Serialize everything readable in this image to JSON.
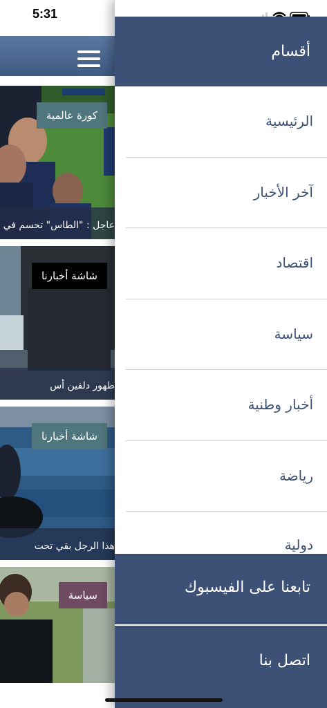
{
  "status_bar": {
    "time": "5:31",
    "icons": [
      "signal-icon",
      "wifi-icon",
      "battery-icon"
    ]
  },
  "main": {
    "app_bar": {
      "menu_icon": "hamburger-menu-icon"
    },
    "cards": [
      {
        "badge": "كورة عالمية",
        "badge_color": "#4f767c",
        "caption": "عاجل : \"الطاس\" تحسم في"
      },
      {
        "badge": "شاشة أخبارنا",
        "badge_color": "#000000",
        "caption": "ظهور دلفين أس"
      },
      {
        "badge": "شاشة أخبارنا",
        "badge_color": "#4f767c",
        "caption": "هذا الرجل بقي تحت"
      },
      {
        "badge": "سياسة",
        "badge_color": "#6e4b63",
        "caption": ""
      }
    ]
  },
  "drawer": {
    "header_title": "أقسام",
    "items": [
      {
        "label": "الرئيسية"
      },
      {
        "label": "آخر الأخبار"
      },
      {
        "label": "اقتصاد"
      },
      {
        "label": "سياسة"
      },
      {
        "label": "أخبار وطنية"
      },
      {
        "label": "رياضة"
      },
      {
        "label": "دولية"
      }
    ],
    "facebook_label": "تابعنا على الفيسبوك",
    "contact_label": "اتصل بنا"
  },
  "colors": {
    "brand_navy": "#3c5175",
    "app_bar": "#4a6791",
    "menu_text": "#3c5175",
    "divider": "#cfd3d8"
  }
}
